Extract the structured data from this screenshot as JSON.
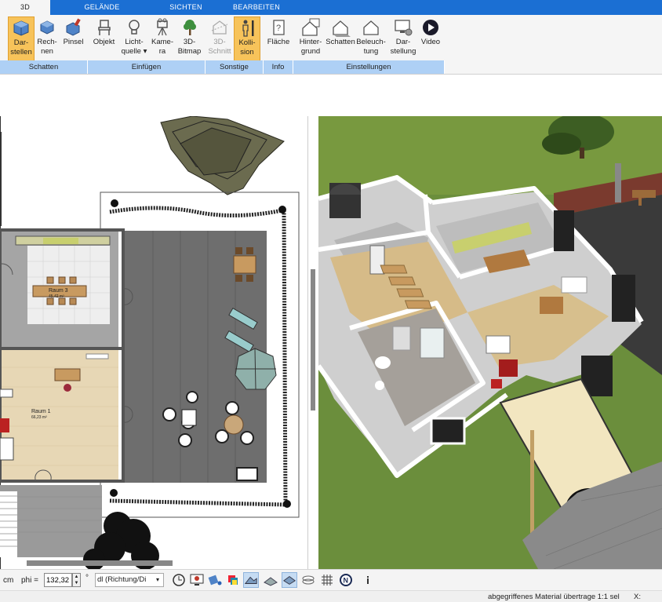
{
  "tabs": [
    {
      "label": "3D",
      "active": true
    },
    {
      "label": "GELÄNDE",
      "active": false
    },
    {
      "label": "SICHTEN",
      "active": false
    },
    {
      "label": "BEARBEITEN",
      "active": false
    }
  ],
  "ribbon": {
    "buttons": [
      {
        "line1": "Dar-",
        "line2": "stellen",
        "icon": "cube-display-icon",
        "active": true
      },
      {
        "line1": "Rech-",
        "line2": "nen",
        "icon": "cube-compute-icon"
      },
      {
        "line1": "Pinsel",
        "line2": "",
        "icon": "brush-cube-icon"
      },
      {
        "line1": "Objekt",
        "line2": "",
        "icon": "chair-icon"
      },
      {
        "line1": "Licht-",
        "line2": "quelle ▾",
        "icon": "lightbulb-icon"
      },
      {
        "line1": "Kame-",
        "line2": "ra",
        "icon": "camera-icon"
      },
      {
        "line1": "3D-",
        "line2": "Bitmap",
        "icon": "tree-icon"
      },
      {
        "line1": "3D-",
        "line2": "Schnitt",
        "icon": "section-icon",
        "disabled": true
      },
      {
        "line1": "Kolli-",
        "line2": "sion",
        "icon": "person-icon",
        "active": true
      },
      {
        "line1": "Fläche",
        "line2": "",
        "icon": "area-icon"
      },
      {
        "line1": "Hinter-",
        "line2": "grund",
        "icon": "house-background-icon"
      },
      {
        "line1": "Schatten",
        "line2": "",
        "icon": "house-shadow-icon"
      },
      {
        "line1": "Beleuch-",
        "line2": "tung",
        "icon": "house-light-icon"
      },
      {
        "line1": "Dar-",
        "line2": "stellung",
        "icon": "monitor-settings-icon"
      },
      {
        "line1": "Video",
        "line2": "",
        "icon": "play-icon"
      }
    ],
    "groups": [
      "Schatten",
      "Einfügen",
      "Sonstige",
      "Info",
      "Einstellungen"
    ]
  },
  "plan": {
    "room3_name": "Raum 3",
    "room3_area": "45,42 m²",
    "room1_name": "Raum 1",
    "room1_area": "66,23 m²"
  },
  "bottom": {
    "unit": "cm",
    "phi_label": "phi =",
    "phi_value": "132,32",
    "degree": "°",
    "direction_select": "dl (Richtung/Di"
  },
  "status": {
    "message": "abgegriffenes Material übertrage 1:1 sel",
    "coord_label": "X:"
  },
  "colors": {
    "tabbar": "#1b6fd3",
    "ribbon_active": "#f7c35a",
    "group_label": "#aed0f5",
    "lawn": "#6d8f3e"
  }
}
